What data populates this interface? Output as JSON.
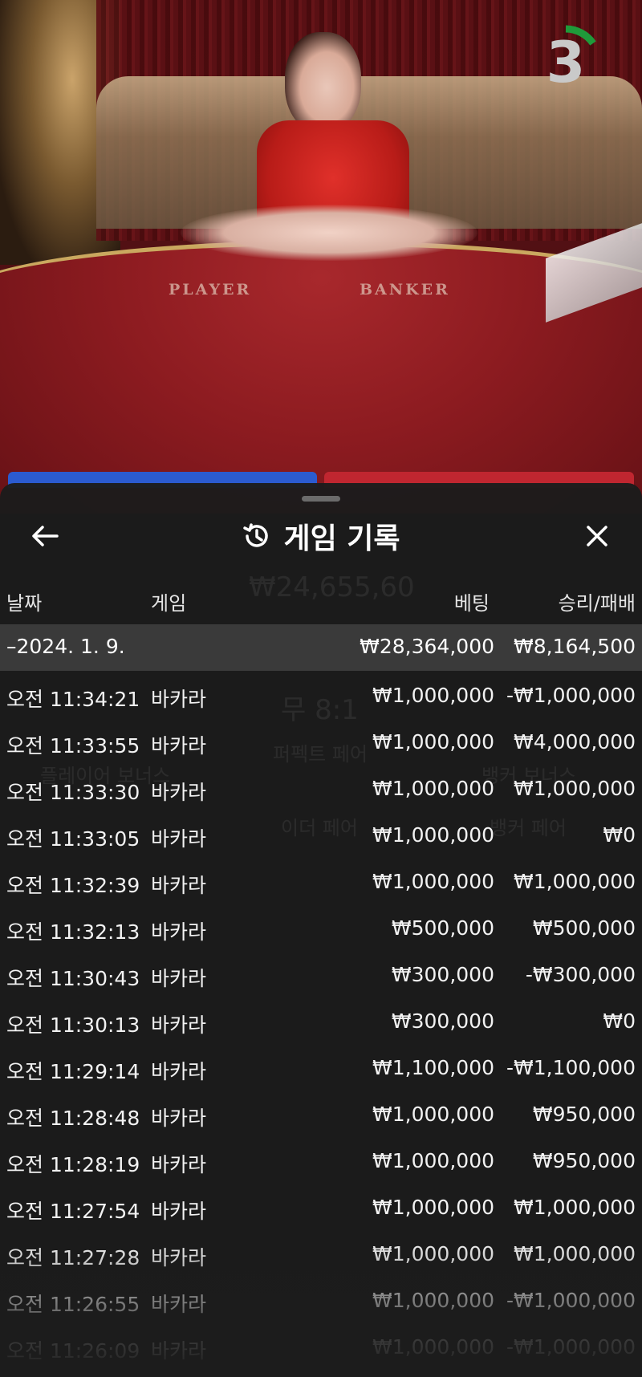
{
  "video": {
    "timer_value": "3",
    "table_label_left": "PLAYER",
    "table_label_right": "BANKER"
  },
  "history": {
    "title": "게임 기록",
    "columns": {
      "date": "날짜",
      "game": "게임",
      "bet": "베팅",
      "win_loss": "승리/패배"
    },
    "summary": {
      "date": "–2024. 1. 9.",
      "bet": "₩28,364,000",
      "win_loss": "₩8,164,500"
    },
    "rows": [
      {
        "time": "오전 11:34:21",
        "game": "바카라",
        "bet": "₩1,000,000",
        "win_loss": "-₩1,000,000"
      },
      {
        "time": "오전 11:33:55",
        "game": "바카라",
        "bet": "₩1,000,000",
        "win_loss": "₩4,000,000"
      },
      {
        "time": "오전 11:33:30",
        "game": "바카라",
        "bet": "₩1,000,000",
        "win_loss": "₩1,000,000"
      },
      {
        "time": "오전 11:33:05",
        "game": "바카라",
        "bet": "₩1,000,000",
        "win_loss": "₩0"
      },
      {
        "time": "오전 11:32:39",
        "game": "바카라",
        "bet": "₩1,000,000",
        "win_loss": "₩1,000,000"
      },
      {
        "time": "오전 11:32:13",
        "game": "바카라",
        "bet": "₩500,000",
        "win_loss": "₩500,000"
      },
      {
        "time": "오전 11:30:43",
        "game": "바카라",
        "bet": "₩300,000",
        "win_loss": "-₩300,000"
      },
      {
        "time": "오전 11:30:13",
        "game": "바카라",
        "bet": "₩300,000",
        "win_loss": "₩0"
      },
      {
        "time": "오전 11:29:14",
        "game": "바카라",
        "bet": "₩1,100,000",
        "win_loss": "-₩1,100,000"
      },
      {
        "time": "오전 11:28:48",
        "game": "바카라",
        "bet": "₩1,000,000",
        "win_loss": "₩950,000"
      },
      {
        "time": "오전 11:28:19",
        "game": "바카라",
        "bet": "₩1,000,000",
        "win_loss": "₩950,000"
      },
      {
        "time": "오전 11:27:54",
        "game": "바카라",
        "bet": "₩1,000,000",
        "win_loss": "₩1,000,000"
      },
      {
        "time": "오전 11:27:28",
        "game": "바카라",
        "bet": "₩1,000,000",
        "win_loss": "₩1,000,000"
      },
      {
        "time": "오전 11:26:55",
        "game": "바카라",
        "bet": "₩1,000,000",
        "win_loss": "-₩1,000,000"
      },
      {
        "time": "오전 11:26:09",
        "game": "바카라",
        "bet": "₩1,000,000",
        "win_loss": "-₩1,000,000"
      }
    ]
  },
  "background_ui": {
    "pot": "₩24,655,60",
    "tie": "무 8:1",
    "perfect_pair": "퍼펙트 페어",
    "player_bonus": "플레이어 보너스",
    "banker_bonus": "뱅커 보너스",
    "banker_pair": "뱅커 페어",
    "either_pair": "이더 페어"
  },
  "icons": {
    "back": "arrow-left-icon",
    "history": "history-clock-icon",
    "close": "close-icon"
  },
  "colors": {
    "sheet_bg": "#1c1c1c",
    "summary_bg": "#3a3a3a",
    "timer_arc": "#1f9a3a",
    "player_blue": "#2b5bd0",
    "banker_red": "#c02630"
  }
}
